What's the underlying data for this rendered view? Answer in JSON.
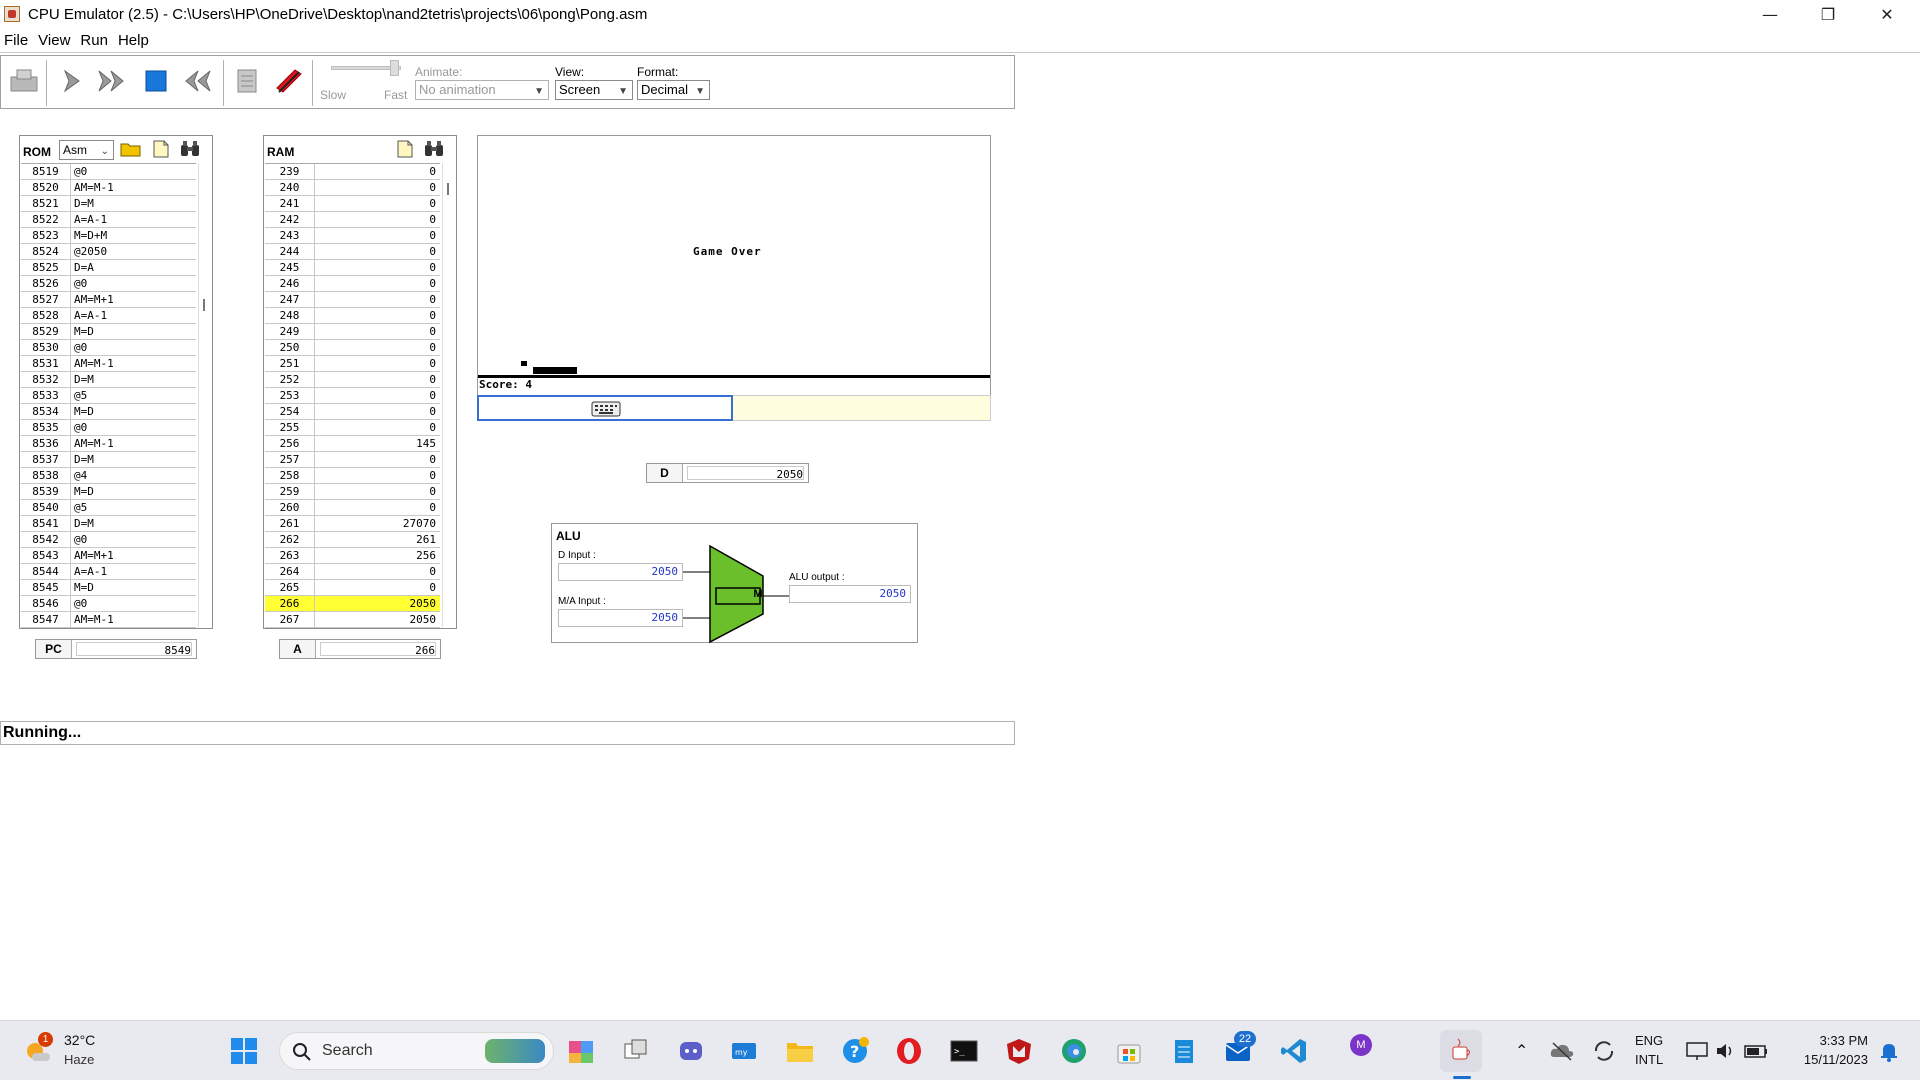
{
  "window": {
    "title": "CPU Emulator (2.5) - C:\\Users\\HP\\OneDrive\\Desktop\\nand2tetris\\projects\\06\\pong\\Pong.asm",
    "minimize": "—",
    "maximize": "❐",
    "close": "✕"
  },
  "menu": {
    "file": "File",
    "view": "View",
    "run": "Run",
    "help": "Help"
  },
  "toolbar": {
    "speed_slow": "Slow",
    "speed_fast": "Fast",
    "animate_label": "Animate:",
    "animate_value": "No animation",
    "view_label": "View:",
    "view_value": "Screen",
    "format_label": "Format:",
    "format_value": "Decimal"
  },
  "rom": {
    "title": "ROM",
    "mode": "Asm",
    "rows": [
      [
        "8519",
        "@0"
      ],
      [
        "8520",
        "AM=M-1"
      ],
      [
        "8521",
        "D=M"
      ],
      [
        "8522",
        "A=A-1"
      ],
      [
        "8523",
        "M=D+M"
      ],
      [
        "8524",
        "@2050"
      ],
      [
        "8525",
        "D=A"
      ],
      [
        "8526",
        "@0"
      ],
      [
        "8527",
        "AM=M+1"
      ],
      [
        "8528",
        "A=A-1"
      ],
      [
        "8529",
        "M=D"
      ],
      [
        "8530",
        "@0"
      ],
      [
        "8531",
        "AM=M-1"
      ],
      [
        "8532",
        "D=M"
      ],
      [
        "8533",
        "@5"
      ],
      [
        "8534",
        "M=D"
      ],
      [
        "8535",
        "@0"
      ],
      [
        "8536",
        "AM=M-1"
      ],
      [
        "8537",
        "D=M"
      ],
      [
        "8538",
        "@4"
      ],
      [
        "8539",
        "M=D"
      ],
      [
        "8540",
        "@5"
      ],
      [
        "8541",
        "D=M"
      ],
      [
        "8542",
        "@0"
      ],
      [
        "8543",
        "AM=M+1"
      ],
      [
        "8544",
        "A=A-1"
      ],
      [
        "8545",
        "M=D"
      ],
      [
        "8546",
        "@0"
      ],
      [
        "8547",
        "AM=M-1"
      ]
    ]
  },
  "ram": {
    "title": "RAM",
    "highlight_index": 27,
    "rows": [
      [
        "239",
        "0"
      ],
      [
        "240",
        "0"
      ],
      [
        "241",
        "0"
      ],
      [
        "242",
        "0"
      ],
      [
        "243",
        "0"
      ],
      [
        "244",
        "0"
      ],
      [
        "245",
        "0"
      ],
      [
        "246",
        "0"
      ],
      [
        "247",
        "0"
      ],
      [
        "248",
        "0"
      ],
      [
        "249",
        "0"
      ],
      [
        "250",
        "0"
      ],
      [
        "251",
        "0"
      ],
      [
        "252",
        "0"
      ],
      [
        "253",
        "0"
      ],
      [
        "254",
        "0"
      ],
      [
        "255",
        "0"
      ],
      [
        "256",
        "145"
      ],
      [
        "257",
        "0"
      ],
      [
        "258",
        "0"
      ],
      [
        "259",
        "0"
      ],
      [
        "260",
        "0"
      ],
      [
        "261",
        "27070"
      ],
      [
        "262",
        "261"
      ],
      [
        "263",
        "256"
      ],
      [
        "264",
        "0"
      ],
      [
        "265",
        "0"
      ],
      [
        "266",
        "2050"
      ],
      [
        "267",
        "2050"
      ]
    ]
  },
  "registers": {
    "pc_label": "PC",
    "pc_value": "8549",
    "a_label": "A",
    "a_value": "266",
    "d_label": "D",
    "d_value": "2050"
  },
  "screen": {
    "message": "Game Over",
    "score": "Score: 4"
  },
  "alu": {
    "title": "ALU",
    "d_input_label": "D Input :",
    "d_input_value": "2050",
    "ma_input_label": "M/A Input :",
    "ma_input_value": "2050",
    "output_label": "ALU output :",
    "output_value": "2050",
    "op": "M",
    "color": "#6abf2a"
  },
  "status": "Running...",
  "taskbar": {
    "weather_temp": "32°C",
    "weather_desc": "Haze",
    "weather_badge": "1",
    "search_placeholder": "Search",
    "lang": "ENG",
    "layout": "INTL",
    "time": "3:33 PM",
    "date": "15/11/2023",
    "outlook_badge": "22",
    "profile_initial": "M"
  }
}
